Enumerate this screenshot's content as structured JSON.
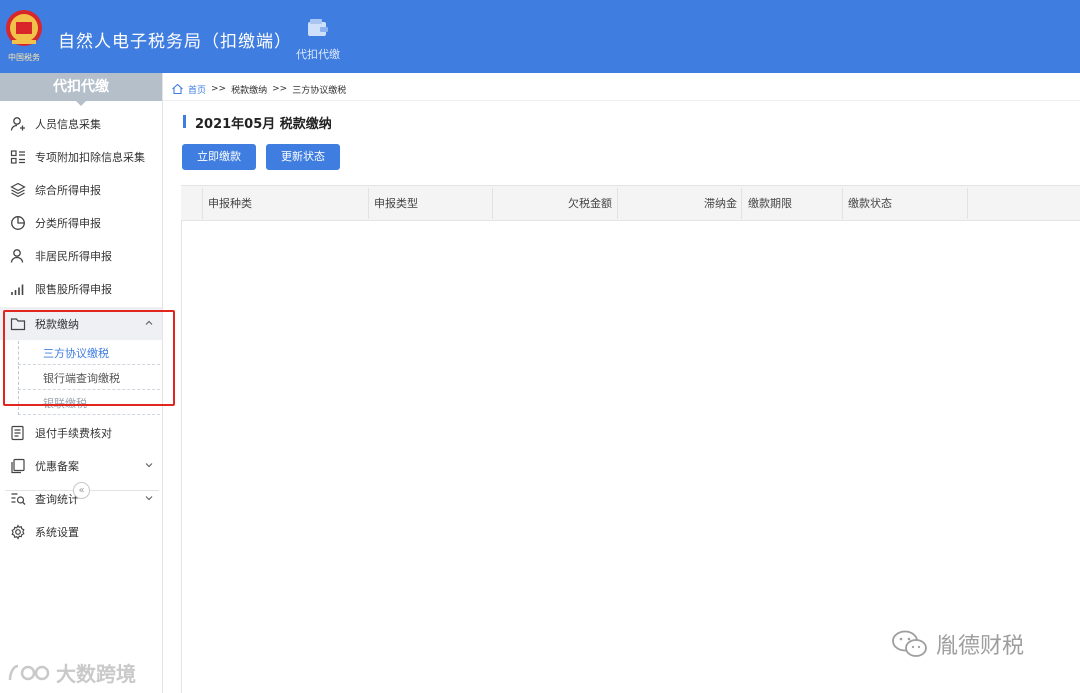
{
  "header": {
    "app_title": "自然人电子税务局（扣缴端）",
    "logo_caption": "中国税务",
    "top_nav": [
      {
        "label": "代扣代缴",
        "icon": "wallet-icon"
      }
    ]
  },
  "sidebar": {
    "title": "代扣代缴",
    "items": [
      {
        "label": "人员信息采集",
        "icon": "person-add-icon"
      },
      {
        "label": "专项附加扣除信息采集",
        "icon": "grid-list-icon"
      },
      {
        "label": "综合所得申报",
        "icon": "layers-icon"
      },
      {
        "label": "分类所得申报",
        "icon": "pie-icon"
      },
      {
        "label": "非居民所得申报",
        "icon": "person-icon"
      },
      {
        "label": "限售股所得申报",
        "icon": "bar-signal-icon"
      },
      {
        "label": "税款缴纳",
        "icon": "folder-icon",
        "expanded": true,
        "children": [
          {
            "label": "三方协议缴税",
            "active": true
          },
          {
            "label": "银行端查询缴税"
          },
          {
            "label": "银联缴税"
          }
        ]
      },
      {
        "label": "退付手续费核对",
        "icon": "document-icon"
      },
      {
        "label": "优惠备案",
        "icon": "copy-icon",
        "has_children": true
      },
      {
        "label": "查询统计",
        "icon": "search-list-icon",
        "has_children": true
      },
      {
        "label": "系统设置",
        "icon": "gear-icon"
      }
    ],
    "collapse_label": "«"
  },
  "breadcrumb": {
    "home": "首页",
    "separator": ">>",
    "items": [
      "税款缴纳",
      "三方协议缴税"
    ]
  },
  "main": {
    "title": "2021年05月  税款缴纳",
    "buttons": {
      "pay_now": "立即缴款",
      "refresh_status": "更新状态"
    },
    "table": {
      "columns": [
        "申报种类",
        "申报类型",
        "欠税金额",
        "滞纳金",
        "缴款期限",
        "缴款状态"
      ],
      "rows": []
    }
  },
  "watermarks": {
    "right": "胤德财税",
    "left": "大数跨境"
  },
  "colors": {
    "header_bg": "#3f7de0",
    "accent": "#3f7de0",
    "highlight_border": "#e0261f",
    "sidebar_head_bg": "#b5bfca"
  }
}
